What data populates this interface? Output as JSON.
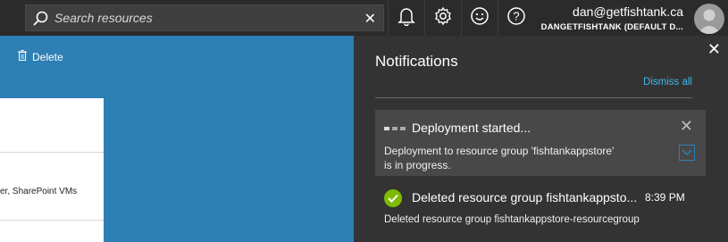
{
  "search": {
    "placeholder": "Search resources",
    "clear_icon": "close-icon"
  },
  "topbar": {
    "icons": [
      "bell-icon",
      "gear-icon",
      "smiley-icon",
      "help-icon"
    ],
    "user_email": "dan@getfishtank.ca",
    "user_tenant": "DANGETFISHTANK (DEFAULT D..."
  },
  "left": {
    "delete_label": "Delete",
    "card_text": "er, SharePoint VMs"
  },
  "notifications": {
    "title": "Notifications",
    "dismiss_all": "Dismiss all",
    "items": [
      {
        "title": "Deployment started...",
        "body": "Deployment to resource group 'fishtankappstore' is in progress.",
        "status": "in-progress"
      },
      {
        "title": "Deleted resource group fishtankappsto...",
        "time": "8:39 PM",
        "body": "Deleted resource group fishtankappstore-resourcegroup",
        "status": "success"
      }
    ]
  },
  "colors": {
    "accent_blue": "#2d7fb4",
    "link": "#3fb7f0",
    "success": "#7fba00",
    "panel_bg": "#333333"
  }
}
